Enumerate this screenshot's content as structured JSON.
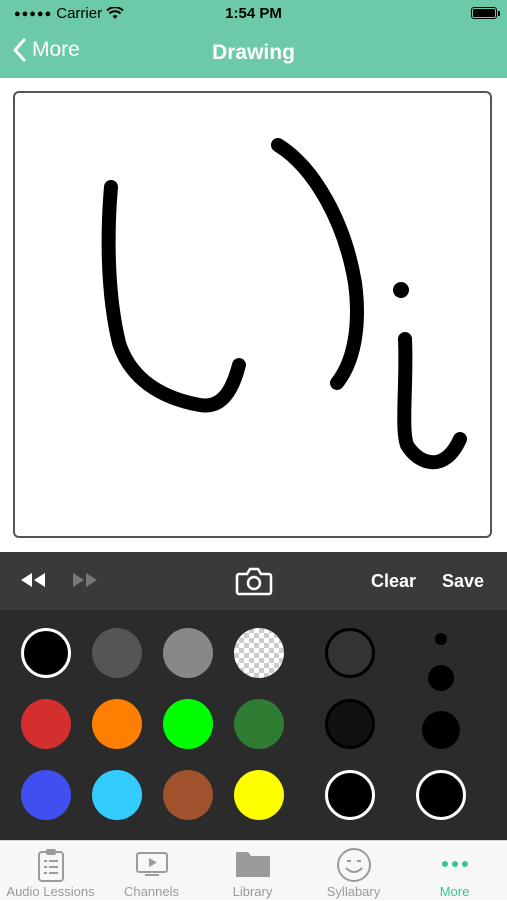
{
  "status_bar": {
    "carrier": "Carrier",
    "time": "1:54 PM"
  },
  "nav": {
    "back_label": "More",
    "title": "Drawing"
  },
  "toolbar": {
    "clear_label": "Clear",
    "save_label": "Save",
    "undo_icon": "rewind-icon",
    "redo_icon": "fast-forward-icon",
    "camera_icon": "camera-icon"
  },
  "palette": {
    "colors": [
      "#000000",
      "#555555",
      "#888888",
      "transparent",
      "#d32f2f",
      "#ff7f00",
      "#00ff00",
      "#2e7d32",
      "#3f4ff0",
      "#33ccff",
      "#a0522d",
      "#ffff00"
    ],
    "selected_color": "#000000",
    "opacity_levels": [
      "#333333",
      "#111111",
      "#000000"
    ],
    "brush_sizes": [
      "small",
      "medium",
      "large",
      "x-large"
    ]
  },
  "tabs": [
    {
      "label": "Audio Lessions",
      "icon": "clipboard-icon",
      "active": false
    },
    {
      "label": "Channels",
      "icon": "tv-icon",
      "active": false
    },
    {
      "label": "Library",
      "icon": "folder-icon",
      "active": false
    },
    {
      "label": "Syllabary",
      "icon": "smiley-icon",
      "active": false
    },
    {
      "label": "More",
      "icon": "more-dots-icon",
      "active": true
    }
  ],
  "colors": {
    "header_green": "#6ccaa9",
    "active_tab": "#35c29a",
    "toolbar_bg": "#3a3a3a",
    "palette_bg": "#2b2b2b"
  }
}
